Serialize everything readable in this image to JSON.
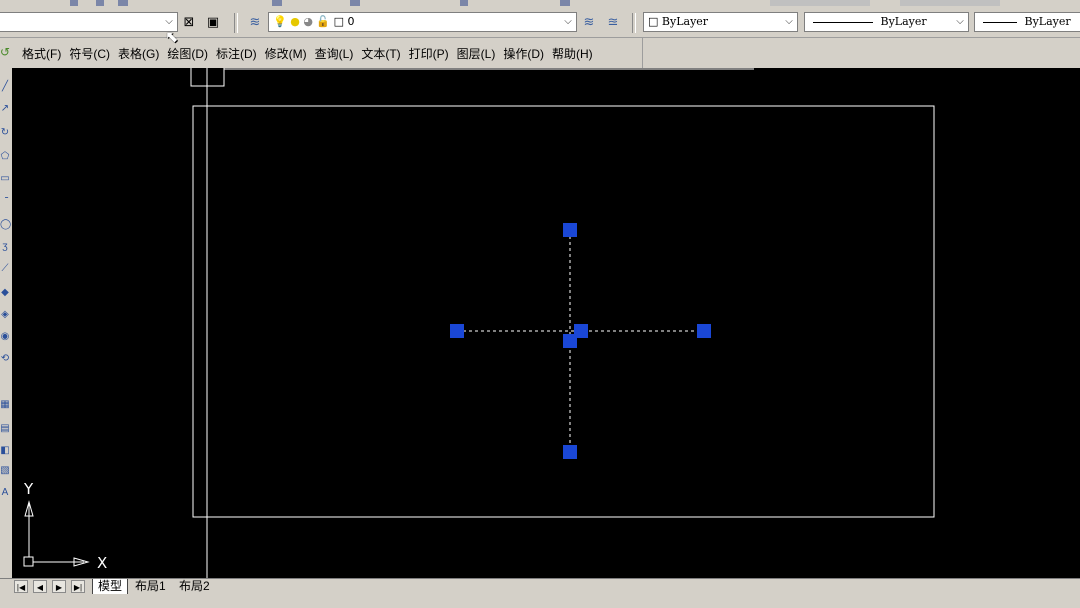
{
  "layer_panel": {
    "layer_name": "0",
    "icons": [
      "layers-icon",
      "bulb-on-icon",
      "sun-icon",
      "lock-icon",
      "color-swatch-icon"
    ]
  },
  "properties": {
    "color": "ByLayer",
    "linetype": "ByLayer",
    "lineweight": "ByLayer"
  },
  "menu": {
    "items": [
      "格式(F)",
      "符号(C)",
      "表格(G)",
      "绘图(D)",
      "标注(D)",
      "修改(M)",
      "查询(L)",
      "文本(T)",
      "打印(P)",
      "图层(L)",
      "操作(D)",
      "帮助(H)"
    ]
  },
  "canvas": {
    "background": "#000000",
    "ucs": {
      "x_label": "X",
      "y_label": "Y"
    },
    "grip_color": "#1a47d6",
    "line_color": "#ffffff"
  },
  "tabs": {
    "items": [
      "模型",
      "布局1",
      "布局2"
    ],
    "active": "模型"
  }
}
